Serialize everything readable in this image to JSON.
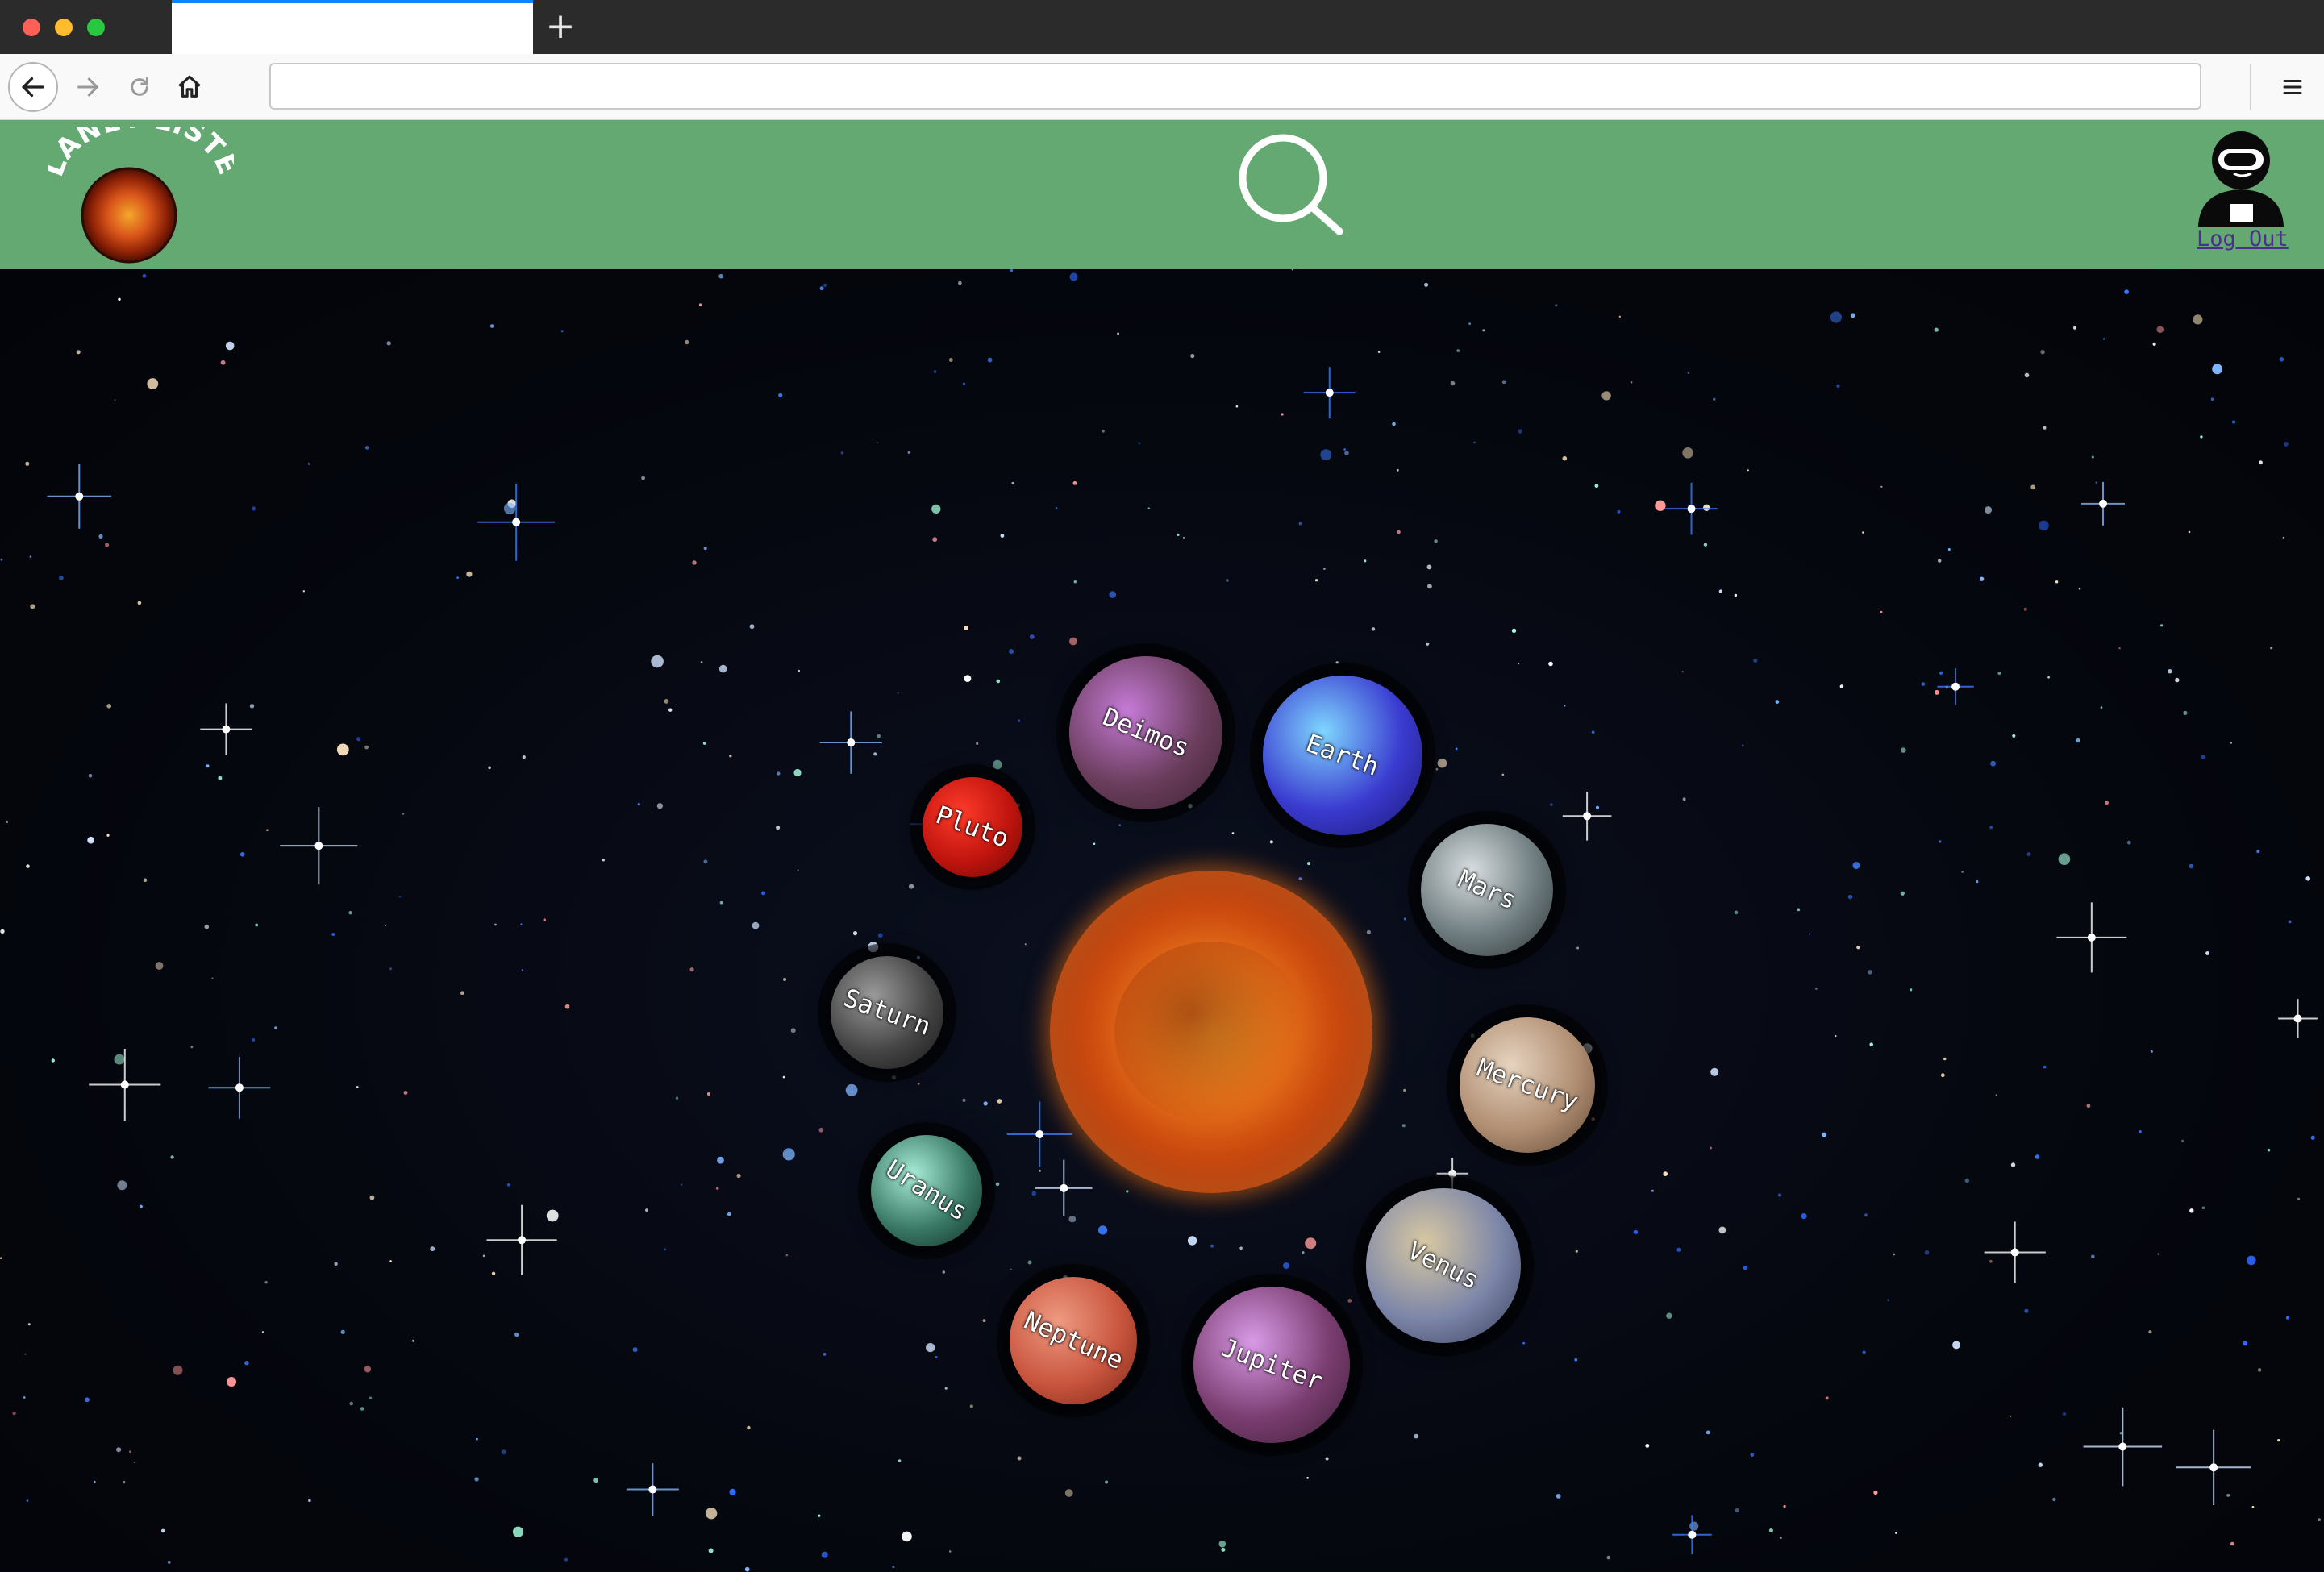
{
  "browser": {
    "url": ""
  },
  "site": {
    "logo_text": "PLANET LISTER",
    "logout_label": "Log Out"
  },
  "planets": [
    {
      "label": "Deimos",
      "colors": [
        "#c57ad6",
        "#6a3d5c",
        "#3b2230"
      ],
      "rotate": 22
    },
    {
      "label": "Earth",
      "colors": [
        "#7fd6ff",
        "#3a3bd0",
        "#1a1470"
      ],
      "rotate": 20
    },
    {
      "label": "Pluto",
      "colors": [
        "#ff3b2a",
        "#c0140e",
        "#6a0804"
      ],
      "rotate": 20
    },
    {
      "label": "Mars",
      "colors": [
        "#d8dde0",
        "#6f7d80",
        "#2e3436"
      ],
      "rotate": 24
    },
    {
      "label": "Saturn",
      "colors": [
        "#9a9a9a",
        "#454545",
        "#151515"
      ],
      "rotate": 20
    },
    {
      "label": "Mercury",
      "colors": [
        "#e6d3bf",
        "#b08e72",
        "#5e4636"
      ],
      "rotate": 20
    },
    {
      "label": "Uranus",
      "colors": [
        "#a7ecd6",
        "#3a7a66",
        "#0f2a24"
      ],
      "rotate": 32
    },
    {
      "label": "Venus",
      "colors": [
        "#d8c8a2",
        "#7c86a8",
        "#3a3f5e"
      ],
      "rotate": 26
    },
    {
      "label": "Neptune",
      "colors": [
        "#ef9a82",
        "#c9553e",
        "#7a2616"
      ],
      "rotate": 24
    },
    {
      "label": "Jupiter",
      "colors": [
        "#d89ae6",
        "#7a3d70",
        "#3a1f34"
      ],
      "rotate": 20
    }
  ],
  "colors": {
    "header_green": "#64a872",
    "space_bg": "#05070e",
    "logout_link": "#4b2f8f"
  },
  "icons": {
    "back": "arrow-left-icon",
    "forward": "arrow-right-icon",
    "reload": "reload-icon",
    "home": "home-icon",
    "menu": "hamburger-menu-icon",
    "search": "magnifier-icon",
    "avatar": "astronaut-icon"
  }
}
